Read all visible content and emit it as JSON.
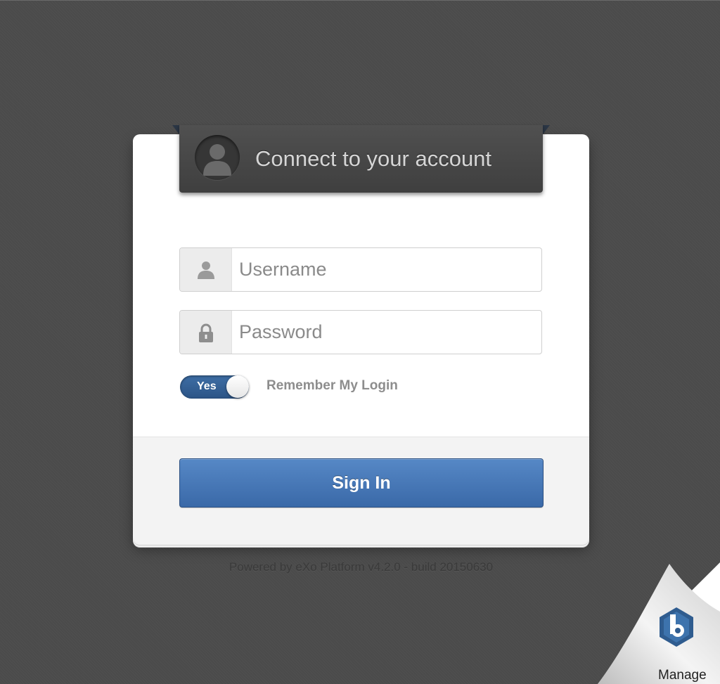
{
  "header": {
    "title": "Connect to your account",
    "avatar_icon": "user-avatar-icon"
  },
  "form": {
    "username": {
      "placeholder": "Username",
      "value": "",
      "icon": "user-icon"
    },
    "password": {
      "placeholder": "Password",
      "value": "",
      "icon": "lock-icon"
    },
    "remember": {
      "toggle_text": "Yes",
      "label": "Remember My Login",
      "checked": true
    },
    "submit_label": "Sign In"
  },
  "footer": {
    "powered_by": "Powered by eXo Platform v4.2.0 - build 20150630"
  },
  "manage": {
    "label": "Manage",
    "icon": "manage-hexagon-icon"
  },
  "colors": {
    "accent": "#3e6ea5",
    "button": "#4a7cbc",
    "background": "#4b4b4b",
    "ribbon": "#464646",
    "manage_icon": "#2f5c8f"
  }
}
